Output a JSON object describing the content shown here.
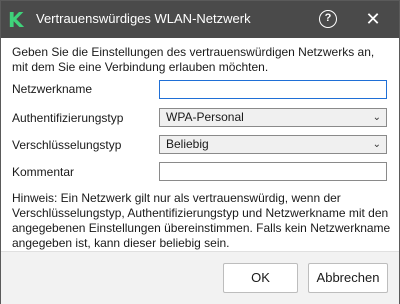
{
  "window": {
    "title": "Vertrauenswürdiges WLAN-Netzwerk",
    "logo_letter": "K",
    "help_symbol": "?",
    "close_symbol": "✕"
  },
  "intro": "Geben Sie die Einstellungen des vertrauenswürdigen Netzwerks an, mit dem Sie eine Verbindung erlauben möchten.",
  "form": {
    "network_name": {
      "label": "Netzwerkname",
      "value": ""
    },
    "auth_type": {
      "label": "Authentifizierungstyp",
      "value": "WPA-Personal"
    },
    "encryption_type": {
      "label": "Verschlüsselungstyp",
      "value": "Beliebig"
    },
    "comment": {
      "label": "Kommentar",
      "value": ""
    }
  },
  "hint": "Hinweis: Ein Netzwerk gilt nur als vertrauenswürdig, wenn der Verschlüsselungstyp, Authentifizierungstyp und Netzwerkname mit den angegebenen Einstellungen übereinstimmen. Falls kein Netzwerkname angegeben ist, kann dieser beliebig sein.",
  "buttons": {
    "ok": "OK",
    "cancel": "Abbrechen"
  },
  "colors": {
    "titlebar": "#4a4a4a",
    "logo": "#3fd27a",
    "focus_border": "#1f6fd6"
  }
}
